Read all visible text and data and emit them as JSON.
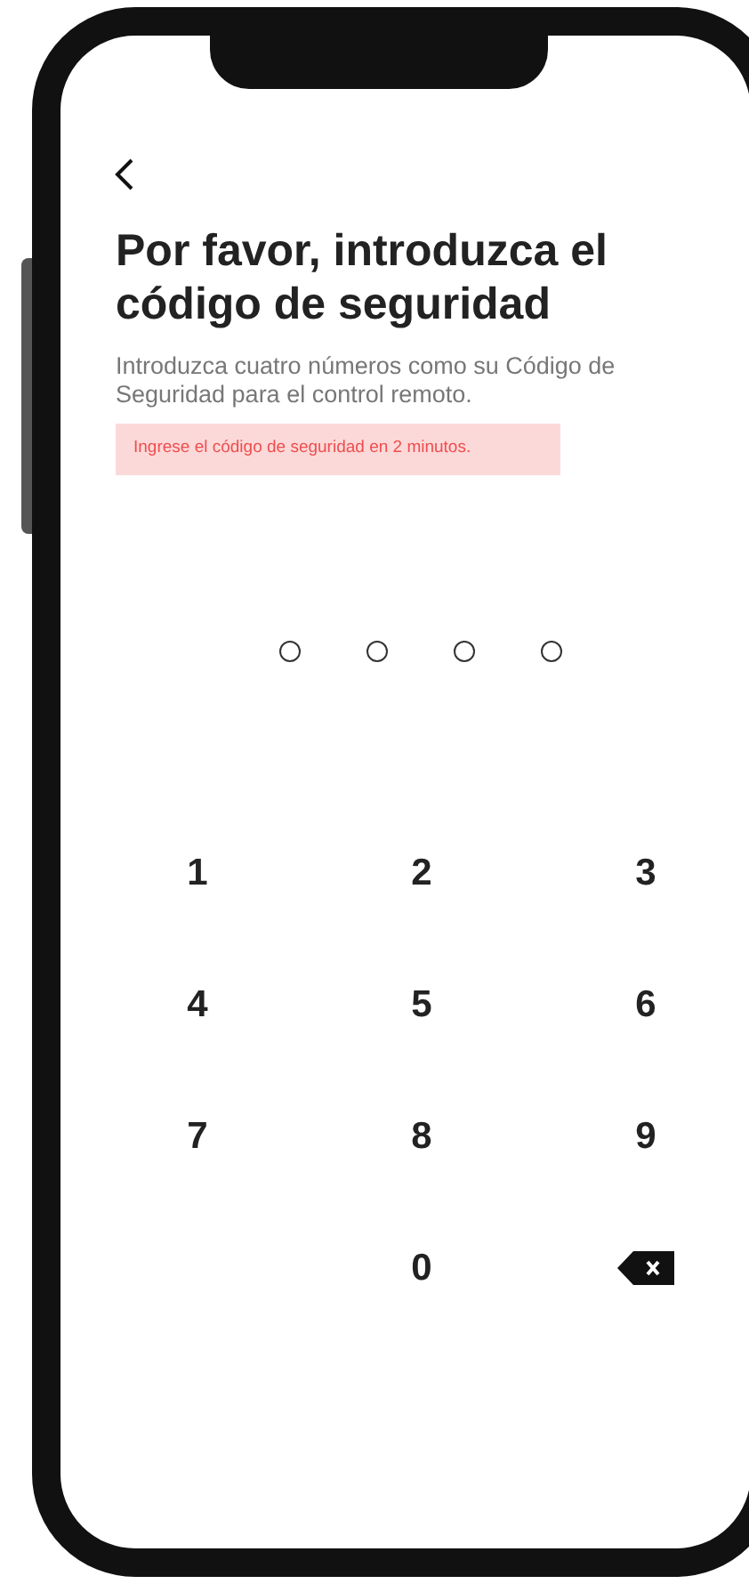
{
  "title": "Por favor, introduzca el código de seguridad",
  "subtitle": "Introduzca cuatro números como su Código de Seguridad para el control remoto.",
  "alert": "Ingrese el código de seguridad en 2 minutos.",
  "pin_dots": [
    {
      "filled": false
    },
    {
      "filled": false
    },
    {
      "filled": false
    },
    {
      "filled": false
    }
  ],
  "keypad": [
    {
      "kind": "digit",
      "label": "1"
    },
    {
      "kind": "digit",
      "label": "2"
    },
    {
      "kind": "digit",
      "label": "3"
    },
    {
      "kind": "digit",
      "label": "4"
    },
    {
      "kind": "digit",
      "label": "5"
    },
    {
      "kind": "digit",
      "label": "6"
    },
    {
      "kind": "digit",
      "label": "7"
    },
    {
      "kind": "digit",
      "label": "8"
    },
    {
      "kind": "digit",
      "label": "9"
    },
    {
      "kind": "blank"
    },
    {
      "kind": "digit",
      "label": "0"
    },
    {
      "kind": "backspace"
    }
  ]
}
